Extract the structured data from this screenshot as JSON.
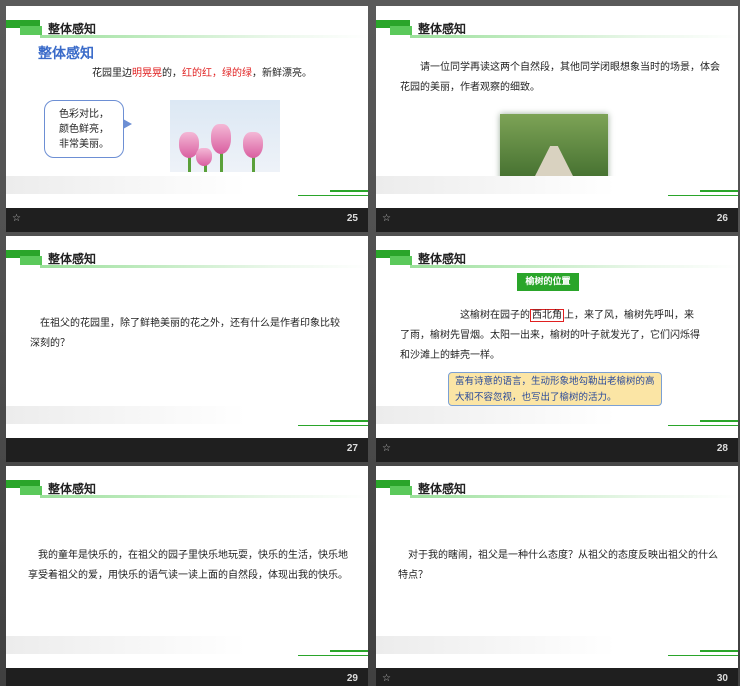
{
  "slides": [
    {
      "header": "整体感知",
      "number": "25",
      "subtitle": "整体感知",
      "line_a": "花园里边",
      "line_b": "明晃晃",
      "line_c": "的，",
      "line_d": "红的红，绿的绿",
      "line_e": "，新鲜漂亮。",
      "bubble": [
        "色彩对比，",
        "颜色鲜亮，",
        "非常美丽。"
      ]
    },
    {
      "header": "整体感知",
      "number": "26",
      "text": "请一位同学再读这两个自然段，其他同学闭眼想象当时的场景，体会花园的美丽，作者观察的细致。"
    },
    {
      "header": "整体感知",
      "number": "27",
      "text": "在祖父的花园里，除了鲜艳美丽的花之外，还有什么是作者印象比较深刻的？"
    },
    {
      "header": "整体感知",
      "number": "28",
      "tag": "榆树的位置",
      "para_a": "这榆树在园子的",
      "para_boxed": "西北角",
      "para_b": "上，来了风，榆树先呼叫，来了雨，榆树先冒烟。太阳一出来，榆树的叶子就发光了，它们闪烁得和沙滩上的蚌壳一样。",
      "note": "富有诗意的语言，生动形象地勾勒出老榆树的高大和不容忽视，也写出了榆树的活力。"
    },
    {
      "header": "整体感知",
      "number": "29",
      "text": "我的童年是快乐的，在祖父的园子里快乐地玩耍，快乐的生活，快乐地享受着祖父的爱，用快乐的语气读一读上面的自然段，体现出我的快乐。"
    },
    {
      "header": "整体感知",
      "number": "30",
      "text": "对于我的瞎闹，祖父是一种什么态度？从祖父的态度反映出祖父的什么特点？"
    }
  ],
  "icons": {
    "star": "slide-transition-star-icon"
  },
  "colors": {
    "accent": "#2aa52a",
    "red": "#e02020",
    "subtitle": "#3a6bc9",
    "note_bg": "#fbe5a5"
  }
}
